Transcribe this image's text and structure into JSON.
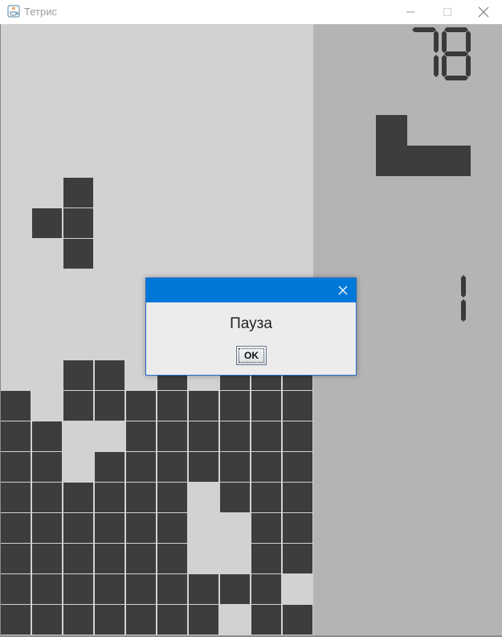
{
  "window": {
    "title": "Тетрис",
    "icon": "java-cup-icon",
    "controls": [
      "minimize-icon",
      "maximize-icon",
      "close-icon"
    ]
  },
  "game": {
    "score": "78",
    "level": "1",
    "next_piece": "L",
    "board_color": "#d2d2d2",
    "side_panel_color": "#b4b4b4",
    "block_color": "#3d3d3d"
  },
  "dialog": {
    "message": "Пауза",
    "ok_label": "OK",
    "title_bar_color": "#0078d7"
  }
}
